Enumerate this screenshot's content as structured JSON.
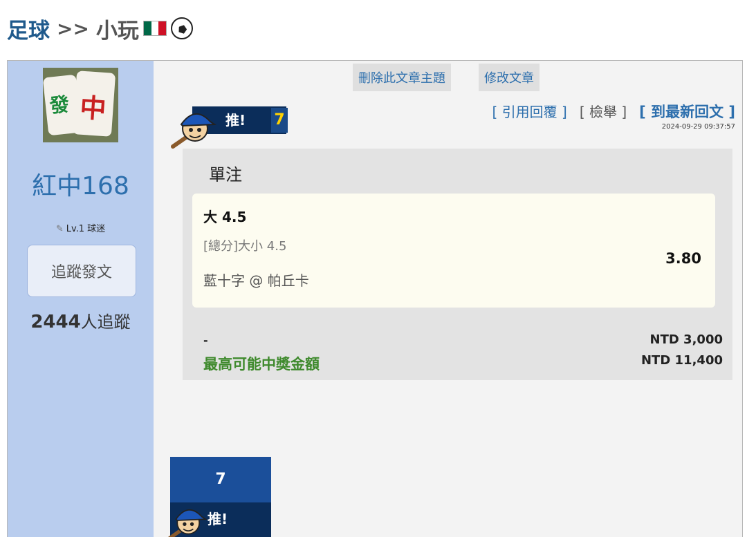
{
  "breadcrumb": {
    "root": "足球",
    "separator": ">>",
    "child": "小玩"
  },
  "colors": {
    "flag_green": "#006847",
    "flag_white": "#ffffff",
    "flag_red": "#ce1126",
    "accent_blue": "#2d6fad",
    "sidebar_bg": "#b9cdee",
    "win_green": "#3f8a2d"
  },
  "icons": {
    "flag": "mexico-flag-icon",
    "ball": "soccer-ball-icon",
    "level": "pencil-icon",
    "mascot": "baseball-mascot-icon"
  },
  "profile": {
    "avatar_chars": [
      "發",
      "中"
    ],
    "name": "紅中168",
    "level": "Lv.1 球迷",
    "follow_button": "追蹤發文",
    "follower_count": "2444",
    "follower_suffix": "人追蹤"
  },
  "admin": {
    "delete_topic": "刪除此文章主題",
    "edit_post": "修改文章"
  },
  "push": {
    "label": "推!",
    "count": "7"
  },
  "post_links": {
    "quote": "[ 引用回覆 ]",
    "report": "[ 檢舉 ]",
    "latest": "[ 到最新回文 ]"
  },
  "timestamp": "2024-09-29 09:37:57",
  "bet": {
    "type": "單注",
    "pick": "大 4.5",
    "market": "[總分]大小 4.5",
    "match": "藍十字 @ 帕丘卡",
    "odds": "3.80",
    "stake_label": "-",
    "stake_amount": "NTD 3,000",
    "max_win_label": "最高可能中獎金額",
    "max_win_amount": "NTD 11,400"
  },
  "push_bottom": {
    "count": "7",
    "label": "推!"
  }
}
